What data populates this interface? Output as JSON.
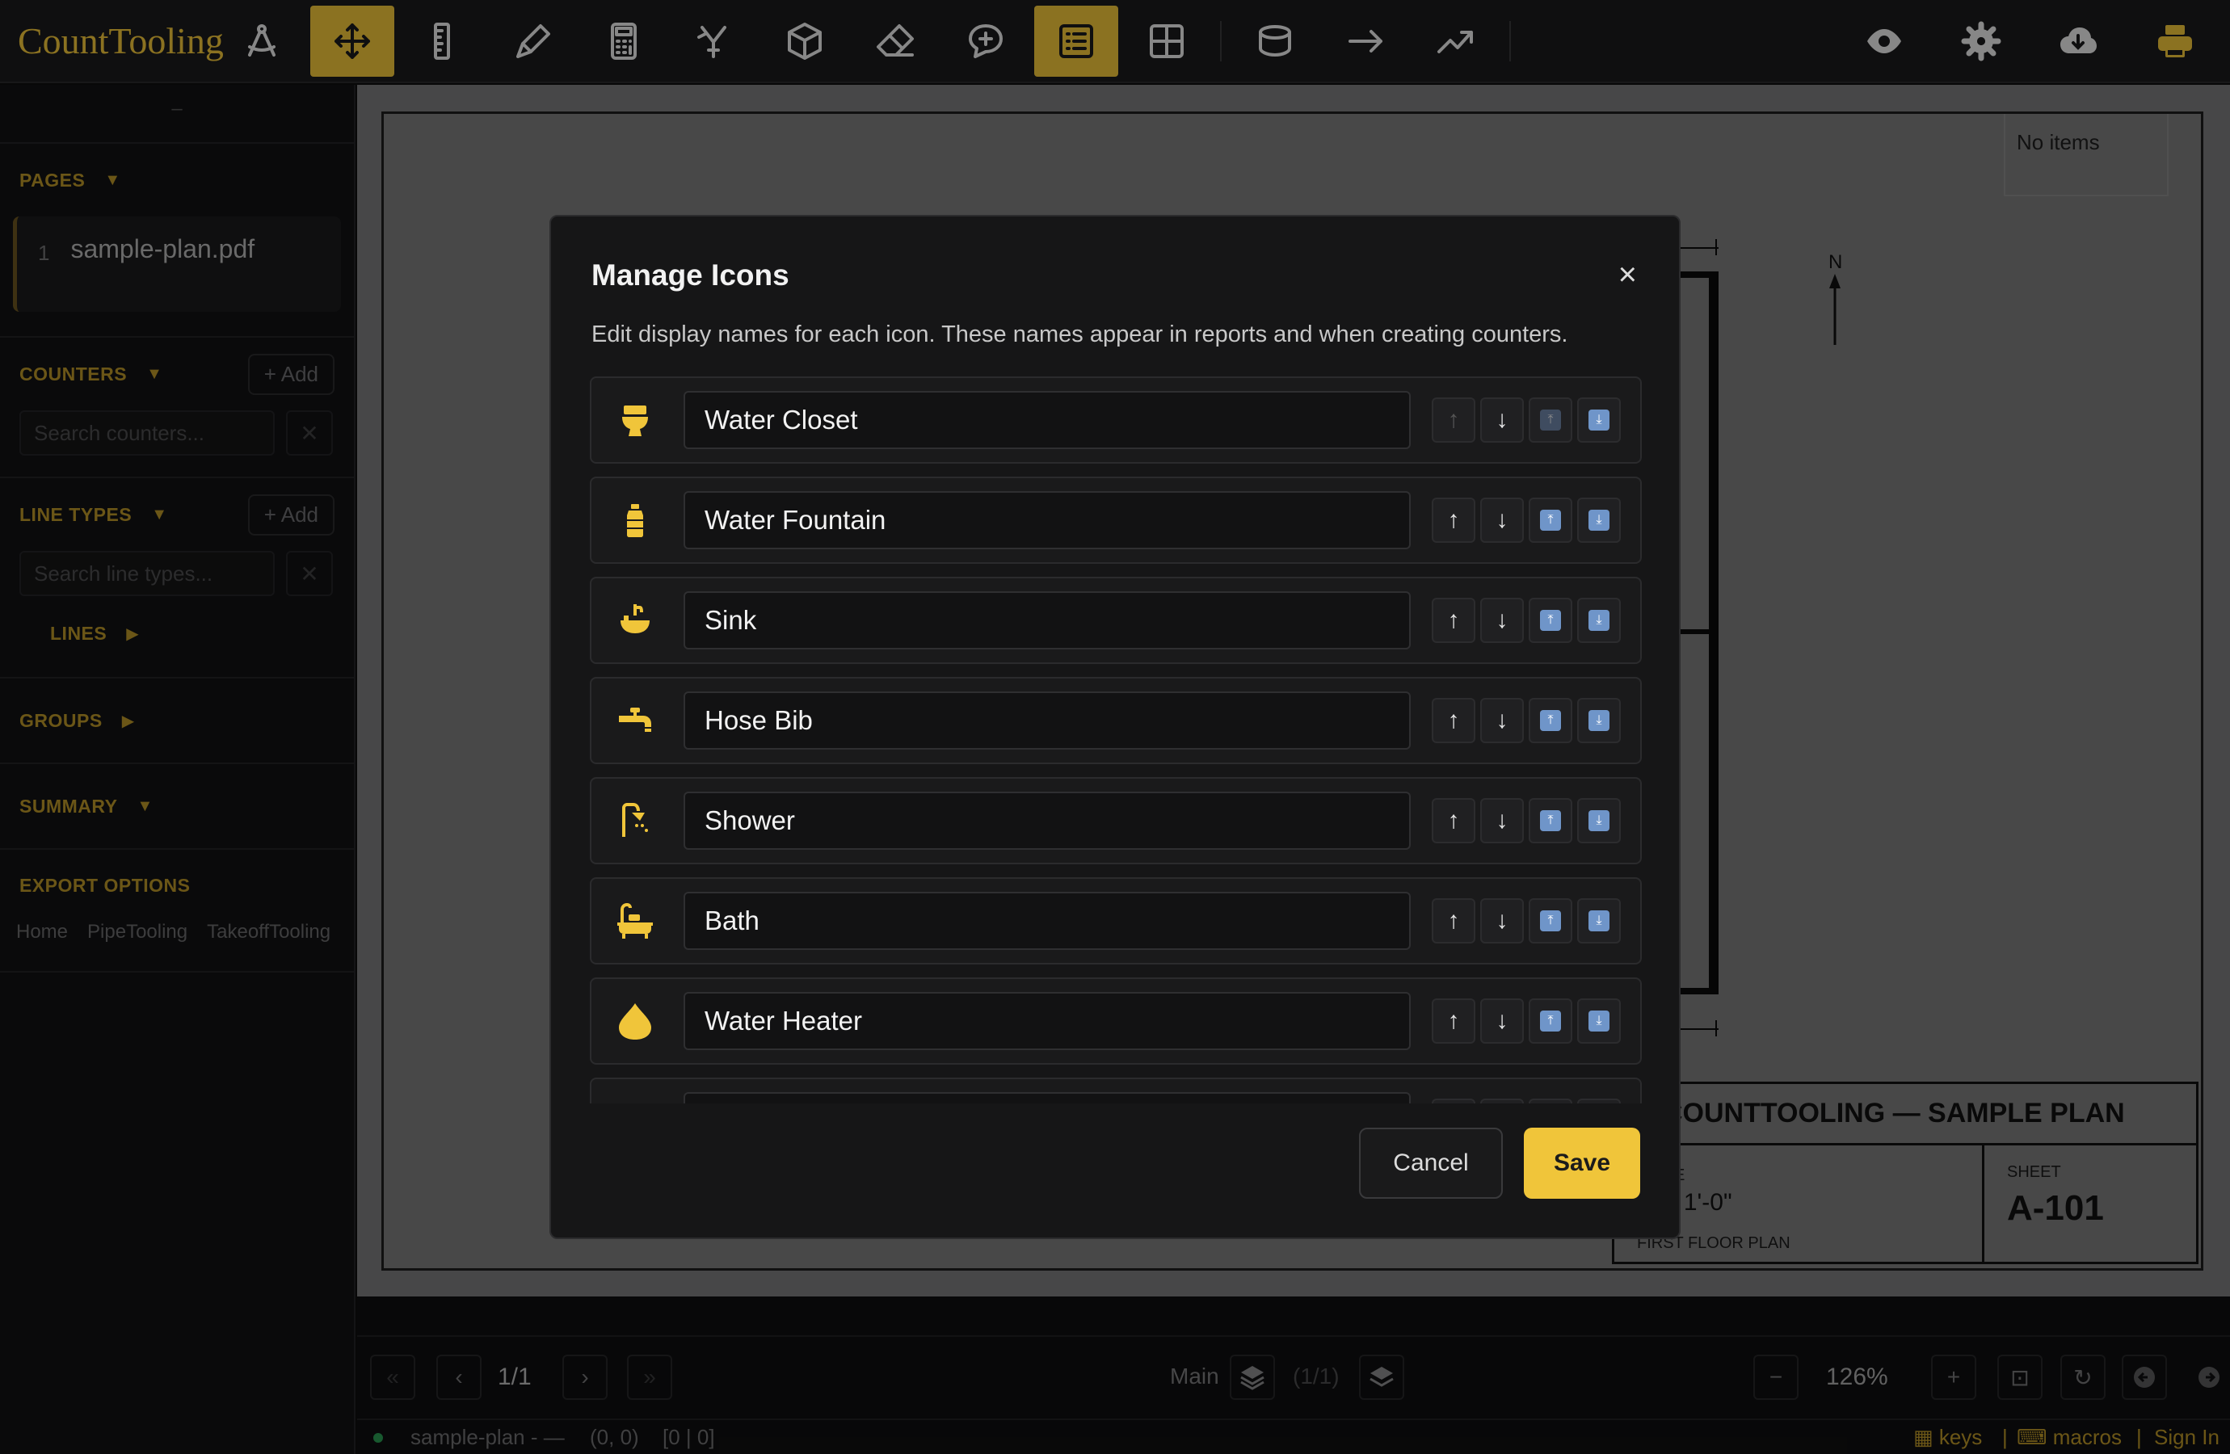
{
  "app": {
    "brand": "CountTooling"
  },
  "sidebar": {
    "top_label": "–",
    "pages": {
      "title": "PAGES",
      "items": [
        {
          "num": "1",
          "name": "sample-plan.pdf"
        }
      ]
    },
    "counters": {
      "title": "COUNTERS",
      "add_label": "+ Add",
      "search_placeholder": "Search counters..."
    },
    "line_types": {
      "title": "LINE TYPES",
      "add_label": "+ Add",
      "search_placeholder": "Search line types..."
    },
    "lines": {
      "title": "LINES"
    },
    "groups": {
      "title": "GROUPS"
    },
    "summary": {
      "title": "SUMMARY"
    },
    "export": {
      "title": "EXPORT OPTIONS",
      "links": [
        "Home",
        "PipeTooling",
        "TakeoffTooling"
      ]
    }
  },
  "canvas": {
    "no_items": "No items",
    "north": "N",
    "title_block": {
      "heading": "COUNTTOOLING — SAMPLE PLAN",
      "scale_label": "E",
      "scale_value": "= 1'-0\"",
      "plan_name": "FIRST FLOOR PLAN",
      "sheet_label": "SHEET",
      "sheet_number": "A-101"
    }
  },
  "bottom": {
    "first": "«",
    "prev": "‹",
    "page": "1/1",
    "next": "›",
    "last": "»",
    "layer": "Main",
    "layer_count": "(1/1)",
    "zoom_out": "−",
    "zoom": "126%",
    "zoom_in": "+",
    "status_file": "sample-plan - —",
    "status_coords": "(0, 0)",
    "status_grid": "[0 | 0]",
    "keys": "keys",
    "macros": "macros",
    "sign_in": "Sign In",
    "sep": "|"
  },
  "modal": {
    "title": "Manage Icons",
    "close": "×",
    "description": "Edit display names for each icon. These names appear in reports and when creating counters.",
    "rows": [
      {
        "icon": "toilet-icon",
        "name": "Water Closet",
        "up_disabled": true,
        "top_disabled": true
      },
      {
        "icon": "bottle-icon",
        "name": "Water Fountain",
        "up_disabled": false,
        "top_disabled": false
      },
      {
        "icon": "sink-icon",
        "name": "Sink",
        "up_disabled": false,
        "top_disabled": false
      },
      {
        "icon": "faucet-icon",
        "name": "Hose Bib",
        "up_disabled": false,
        "top_disabled": false
      },
      {
        "icon": "shower-icon",
        "name": "Shower",
        "up_disabled": false,
        "top_disabled": false
      },
      {
        "icon": "bath-icon",
        "name": "Bath",
        "up_disabled": false,
        "top_disabled": false
      },
      {
        "icon": "droplet-icon",
        "name": "Water Heater",
        "up_disabled": false,
        "top_disabled": false
      }
    ],
    "btn_glyphs": {
      "up": "↑",
      "down": "↓",
      "top": "⤒",
      "bottom": "⤓"
    },
    "cancel": "Cancel",
    "save": "Save"
  },
  "colors": {
    "accent": "#f0c53a",
    "background": "#0e0e0f",
    "panel": "#161617",
    "canvas": "#7b7b7c"
  }
}
